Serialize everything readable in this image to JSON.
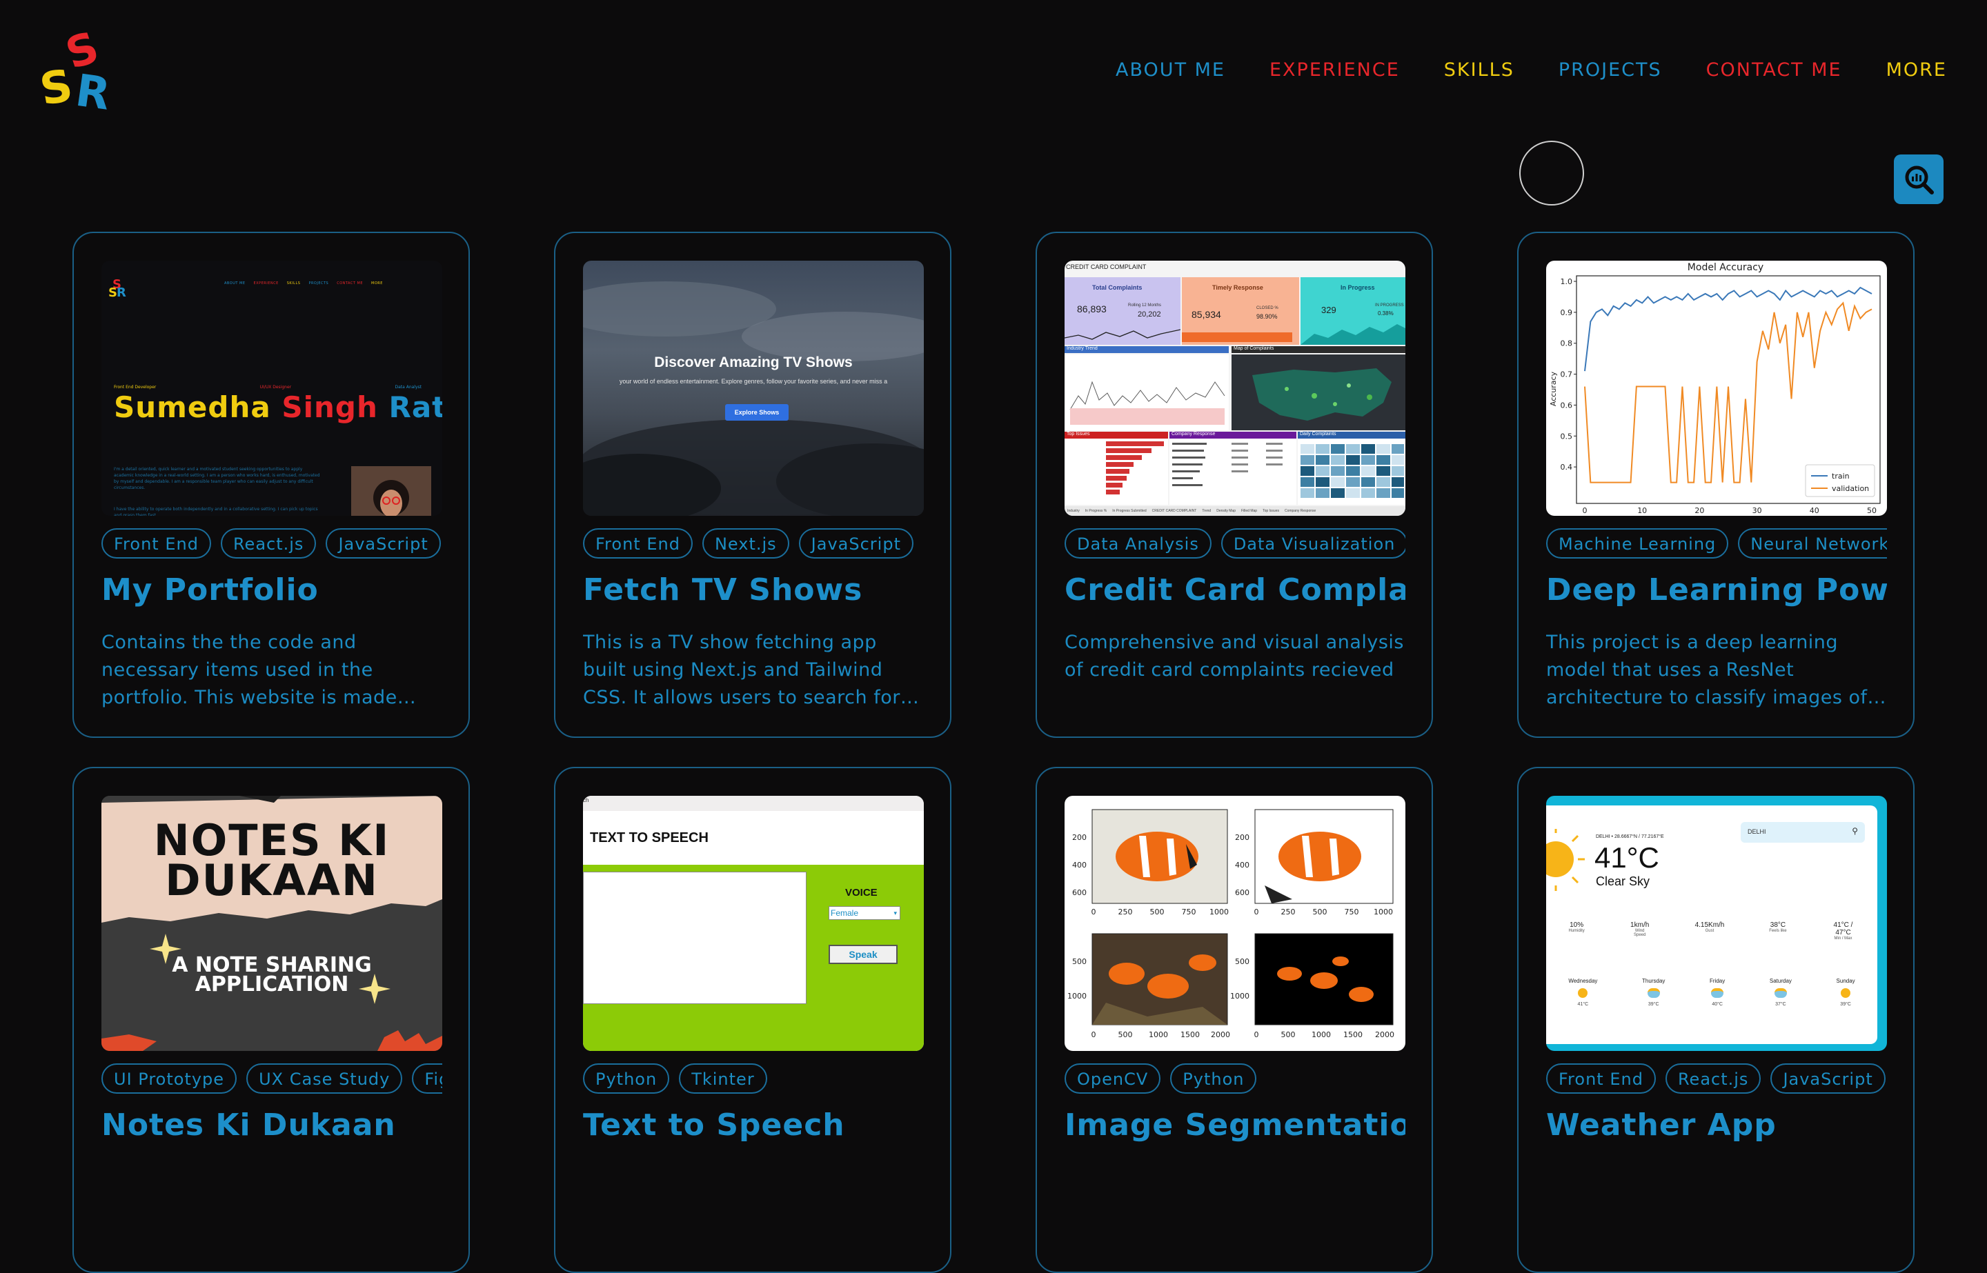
{
  "logo": {
    "letters": "SSR"
  },
  "nav": [
    {
      "label": "ABOUT ME",
      "color": "#1e8fc9"
    },
    {
      "label": "EXPERIENCE",
      "color": "#e8262b"
    },
    {
      "label": "SKILLS",
      "color": "#f0cc10"
    },
    {
      "label": "PROJECTS",
      "color": "#1e8fc9"
    },
    {
      "label": "CONTACT ME",
      "color": "#e8262b"
    },
    {
      "label": "MORE",
      "color": "#f0cc10"
    }
  ],
  "search_button": {
    "icon": "search-chart-icon"
  },
  "projects": [
    {
      "title": "My Portfolio",
      "tags": [
        "Front End",
        "React.js",
        "JavaScript"
      ],
      "description": "Contains the the code and necessary items used in the portfolio. This website is made using React and deployed on Vercel.",
      "thumb": {
        "nav": [
          "ABOUT ME",
          "EXPERIENCE",
          "SKILLS",
          "PROJECTS",
          "CONTACT ME",
          "MORE"
        ],
        "roles": [
          "Front End Developer",
          "UI/UX Designer",
          "Data Analyst"
        ],
        "name": [
          "Sumedha",
          "Singh",
          "Rathor"
        ],
        "bio": "I'm a detail oriented, quick learner and a motivated student seeking opportunities to apply academic knowledge in a real-world setting. I am a person who works hard, is enthused, motivated by myself and dependable. I am a responsible team player who can easily adjust to any difficult circumstances.",
        "bio2": "I have the ability to operate both independently and in a collaborative setting. I can pick up topics and grasp them fast."
      }
    },
    {
      "title": "Fetch TV Shows",
      "tags": [
        "Front End",
        "Next.js",
        "JavaScript"
      ],
      "description": "This is a TV show fetching app built using Next.js and Tailwind CSS. It allows users to search for TV shows and view their details.",
      "thumb": {
        "heading": "Discover Amazing TV Shows",
        "subtitle": "your world of endless entertainment. Explore genres, follow your favorite series, and never miss a",
        "button": "Explore Shows"
      }
    },
    {
      "title": "Credit Card Complaints Analysis",
      "tags": [
        "Data Analysis",
        "Data Visualization"
      ],
      "description": "Comprehensive and visual analysis of credit card complaints recieved",
      "thumb": {
        "header": "CREDIT CARD COMPLAINT",
        "kpis": [
          {
            "label": "Total Complaints",
            "value": "86,893",
            "sub_label": "Rolling 12 Months",
            "sub_value": "20,202"
          },
          {
            "label": "Timely Response",
            "value": "85,934",
            "sub_label": "CLOSED %",
            "sub_value": "98.90%"
          },
          {
            "label": "In Progress",
            "value": "329",
            "sub_label": "IN PROGRESS",
            "sub_value": "0.38%"
          }
        ],
        "panels": [
          "Industry Trend",
          "Map of Complaints",
          "Top Issues",
          "Company Response",
          "Daily Complaints"
        ],
        "tabs": [
          "Industry",
          "In Progress %",
          "In Progress Submitted",
          "CREDIT CARD COMPLAINT",
          "Trend",
          "Density Map",
          "Filled Map",
          "Top Issues",
          "Company Response"
        ]
      }
    },
    {
      "title": "Deep Learning Powered Image Classifier",
      "tags": [
        "Machine Learning",
        "Neural Network"
      ],
      "description": "This project is a deep learning model that uses a ResNet architecture to classify images of various categories.",
      "thumb": {
        "chart_data": {
          "type": "line",
          "title": "Model Accuracy",
          "ylabel": "Accuracy",
          "xlabel": "",
          "xlim": [
            0,
            50
          ],
          "ylim": [
            0.3,
            1.0
          ],
          "xticks": [
            0,
            10,
            20,
            30,
            40,
            50
          ],
          "yticks": [
            0.4,
            0.5,
            0.6,
            0.7,
            0.8,
            0.9,
            1.0
          ],
          "legend": "bottom-right",
          "series": [
            {
              "name": "train",
              "color": "#3a78b8",
              "values": [
                0.71,
                0.87,
                0.9,
                0.91,
                0.89,
                0.92,
                0.91,
                0.93,
                0.92,
                0.94,
                0.93,
                0.95,
                0.93,
                0.94,
                0.95,
                0.94,
                0.95,
                0.94,
                0.96,
                0.94,
                0.95,
                0.96,
                0.95,
                0.96,
                0.94,
                0.96,
                0.97,
                0.95,
                0.96,
                0.97,
                0.95,
                0.96,
                0.97,
                0.96,
                0.94,
                0.97,
                0.95,
                0.96,
                0.97,
                0.96,
                0.95,
                0.97,
                0.96,
                0.97,
                0.95,
                0.96,
                0.97,
                0.96,
                0.98,
                0.97,
                0.96
              ]
            },
            {
              "name": "validation",
              "color": "#f08a24",
              "values": [
                0.66,
                0.35,
                0.35,
                0.35,
                0.35,
                0.35,
                0.35,
                0.35,
                0.35,
                0.66,
                0.66,
                0.66,
                0.66,
                0.66,
                0.66,
                0.35,
                0.35,
                0.66,
                0.35,
                0.35,
                0.66,
                0.35,
                0.35,
                0.66,
                0.35,
                0.66,
                0.35,
                0.35,
                0.62,
                0.35,
                0.74,
                0.84,
                0.78,
                0.9,
                0.8,
                0.86,
                0.62,
                0.9,
                0.82,
                0.9,
                0.72,
                0.84,
                0.9,
                0.86,
                0.91,
                0.93,
                0.84,
                0.92,
                0.88,
                0.9,
                0.91
              ]
            }
          ]
        }
      }
    },
    {
      "title": "Notes Ki Dukaan",
      "tags": [
        "UI Prototype",
        "UX Case Study",
        "Figma"
      ],
      "description": "",
      "thumb": {
        "line1": "NOTES KI",
        "line2": "DUKAAN",
        "sub1": "A NOTE SHARING",
        "sub2": "APPLICATION"
      }
    },
    {
      "title": "Text to Speech",
      "tags": [
        "Python",
        "Tkinter"
      ],
      "description": "",
      "thumb": {
        "heading": "TEXT TO SPEECH",
        "voice_label": "VOICE",
        "voice_value": "Female",
        "speak": "Speak",
        "corner": "ch"
      }
    },
    {
      "title": "Image Segmentation",
      "tags": [
        "OpenCV",
        "Python"
      ],
      "description": "",
      "thumb": {
        "yticks_top": [
          "200",
          "400",
          "600"
        ],
        "xticks_top": [
          "0",
          "250",
          "500",
          "750",
          "1000"
        ],
        "yticks_bottom": [
          "500",
          "1000"
        ],
        "xticks_bottom": [
          "0",
          "500",
          "1000",
          "1500",
          "2000"
        ]
      }
    },
    {
      "title": "Weather App",
      "tags": [
        "Front End",
        "React.js",
        "JavaScript"
      ],
      "description": "",
      "thumb": {
        "location": "DELHI • 28.6667°N / 77.2167°E",
        "search": "DELHI",
        "temp": "41°C",
        "condition": "Clear Sky",
        "stats": [
          {
            "value": "10%",
            "label": "Humidity"
          },
          {
            "value": "1km/h",
            "label": "Wind Speed"
          },
          {
            "value": "4.15Km/h",
            "label": "Gust"
          },
          {
            "value": "38°C",
            "label": "Feels like"
          },
          {
            "value": "41°C / 47°C",
            "label": "Min / Max"
          }
        ],
        "forecast": [
          {
            "day": "Wednesday",
            "temp": "41°C"
          },
          {
            "day": "Thursday",
            "temp": "39°C"
          },
          {
            "day": "Friday",
            "temp": "40°C"
          },
          {
            "day": "Saturday",
            "temp": "37°C"
          },
          {
            "day": "Sunday",
            "temp": "39°C"
          }
        ]
      }
    }
  ]
}
